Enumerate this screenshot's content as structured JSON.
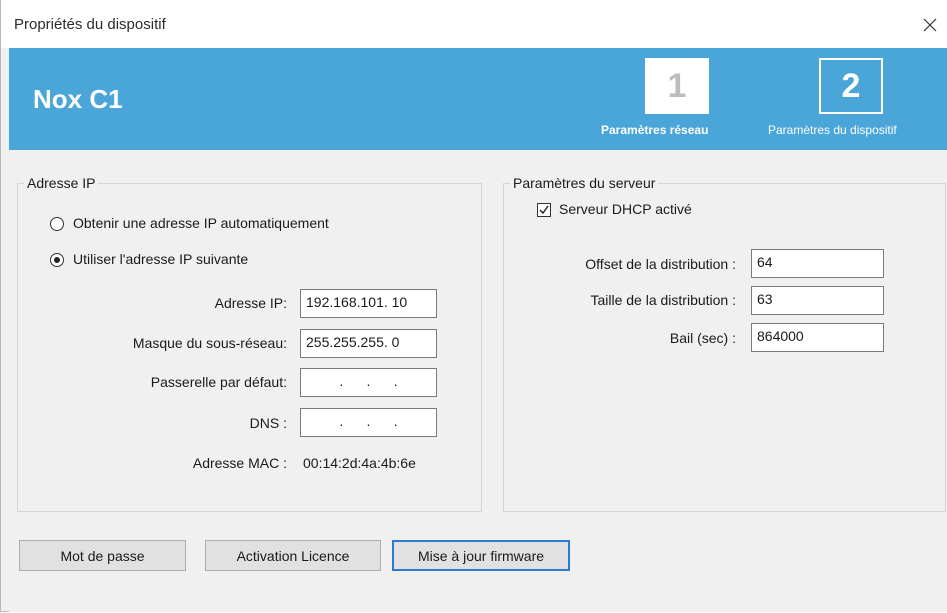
{
  "window": {
    "title": "Propriétés du dispositif"
  },
  "header": {
    "device_name": "Nox C1",
    "steps": [
      {
        "number": "1",
        "label": "Paramètres réseau"
      },
      {
        "number": "2",
        "label": "Paramètres du dispositif"
      }
    ]
  },
  "ip_group": {
    "title": "Adresse IP",
    "radio_auto": "Obtenir une adresse IP automatiquement",
    "radio_manual": "Utiliser l'adresse IP suivante",
    "selected": "manual",
    "ip_label": "Adresse IP:",
    "ip_value": "192.168.101. 10",
    "mask_label": "Masque du sous-réseau:",
    "mask_value": "255.255.255.  0",
    "gateway_label": "Passerelle par défaut:",
    "gateway_value": ".      .      .",
    "dns_label": "DNS :",
    "dns_value": ".      .      .",
    "mac_label": "Adresse MAC :",
    "mac_value": "00:14:2d:4a:4b:6e"
  },
  "server_group": {
    "title": "Paramètres du serveur",
    "dhcp_label": "Serveur DHCP activé",
    "dhcp_checked": true,
    "offset_label": "Offset de la distribution :",
    "offset_value": "64",
    "size_label": "Taille de la distribution :",
    "size_value": "63",
    "lease_label": "Bail (sec) :",
    "lease_value": "864000"
  },
  "buttons": {
    "password": "Mot de passe",
    "license": "Activation Licence",
    "firmware": "Mise à jour firmware"
  },
  "colors": {
    "header_bg": "#4aa6d8",
    "accent_border": "#2f7ad1"
  },
  "icons": {
    "close": "close-icon"
  }
}
